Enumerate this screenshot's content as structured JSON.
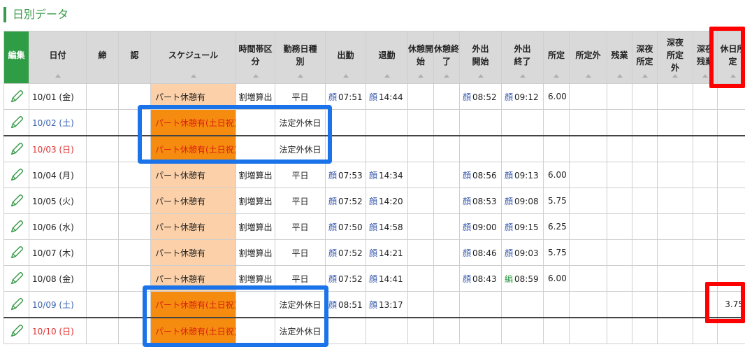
{
  "section_title": "日別データ",
  "headers": {
    "edit": "編集",
    "date": "日付",
    "close": "締",
    "approve": "認",
    "schedule": "スケジュール",
    "time_zone": "時間帯区分",
    "day_type": "勤務日種別",
    "clock_in": "出勤",
    "clock_out": "退勤",
    "break_start": "休憩開始",
    "break_end": "休憩終了",
    "out_start": "外出開始",
    "out_end": "外出終了",
    "scheduled": "所定",
    "non_scheduled": "所定外",
    "overtime": "残業",
    "night_scheduled": "深夜所定",
    "night_non_scheduled": "深夜所定外",
    "night_overtime": "深夜残業",
    "holiday_scheduled": "休日所定"
  },
  "rows": [
    {
      "date": "10/01 (金)",
      "schedule": "パート休憩有",
      "time_zone": "割増算出",
      "day_type": "平日",
      "clock_in": "07:51",
      "clock_out": "14:44",
      "out_start": "08:52",
      "out_end": "09:12",
      "scheduled": "6.00",
      "holiday_scheduled": ""
    },
    {
      "date": "10/02 (土)",
      "schedule": "パート休憩有(土日祝)",
      "time_zone": "",
      "day_type": "法定外休日",
      "clock_in": "",
      "clock_out": "",
      "out_start": "",
      "out_end": "",
      "scheduled": "",
      "holiday_scheduled": ""
    },
    {
      "date": "10/03 (日)",
      "schedule": "パート休憩有(土日祝)",
      "time_zone": "",
      "day_type": "法定外休日",
      "clock_in": "",
      "clock_out": "",
      "out_start": "",
      "out_end": "",
      "scheduled": "",
      "holiday_scheduled": ""
    },
    {
      "date": "10/04 (月)",
      "schedule": "パート休憩有",
      "time_zone": "割増算出",
      "day_type": "平日",
      "clock_in": "07:53",
      "clock_out": "14:34",
      "out_start": "08:56",
      "out_end": "09:13",
      "scheduled": "6.00",
      "holiday_scheduled": ""
    },
    {
      "date": "10/05 (火)",
      "schedule": "パート休憩有",
      "time_zone": "割増算出",
      "day_type": "平日",
      "clock_in": "07:52",
      "clock_out": "14:20",
      "out_start": "08:53",
      "out_end": "09:08",
      "scheduled": "5.75",
      "holiday_scheduled": ""
    },
    {
      "date": "10/06 (水)",
      "schedule": "パート休憩有",
      "time_zone": "割増算出",
      "day_type": "平日",
      "clock_in": "07:50",
      "clock_out": "14:58",
      "out_start": "09:00",
      "out_end": "09:15",
      "scheduled": "6.25",
      "holiday_scheduled": ""
    },
    {
      "date": "10/07 (木)",
      "schedule": "パート休憩有",
      "time_zone": "割増算出",
      "day_type": "平日",
      "clock_in": "07:52",
      "clock_out": "14:21",
      "out_start": "08:46",
      "out_end": "09:03",
      "scheduled": "5.75",
      "holiday_scheduled": ""
    },
    {
      "date": "10/08 (金)",
      "schedule": "パート休憩有",
      "time_zone": "割増算出",
      "day_type": "平日",
      "clock_in": "07:52",
      "clock_out": "14:41",
      "out_start": "08:43",
      "out_end": "08:59",
      "scheduled": "6.00",
      "holiday_scheduled": ""
    },
    {
      "date": "10/09 (土)",
      "schedule": "パート休憩有(土日祝)",
      "time_zone": "",
      "day_type": "法定外休日",
      "clock_in": "08:51",
      "clock_out": "13:17",
      "out_start": "",
      "out_end": "",
      "scheduled": "",
      "holiday_scheduled": "3.75"
    },
    {
      "date": "10/10 (日)",
      "schedule": "パート休憩有(土日祝)",
      "time_zone": "",
      "day_type": "法定外休日",
      "clock_in": "",
      "clock_out": "",
      "out_start": "",
      "out_end": "",
      "scheduled": "",
      "holiday_scheduled": ""
    }
  ],
  "punch_marks": {
    "face": "顔",
    "edit": "編"
  },
  "colors": {
    "green": "#2f9c46",
    "blue_highlight": "#1a73e8",
    "red_highlight": "#ff0000",
    "schedule_bg": "#fcd1a9",
    "holiday_schedule_bg": "#f58c0f"
  }
}
